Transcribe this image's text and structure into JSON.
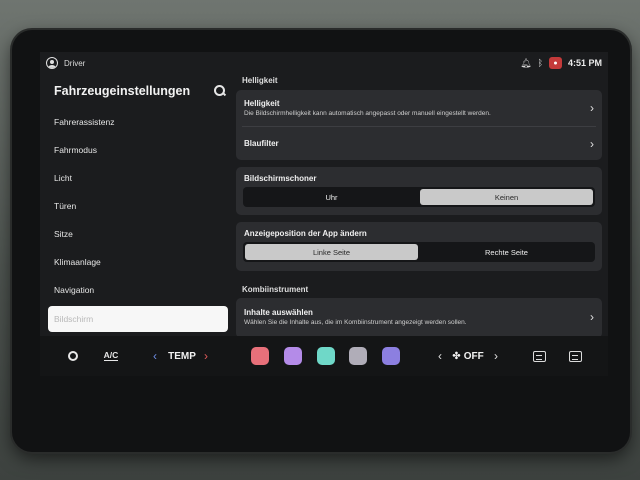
{
  "status": {
    "user": "Driver",
    "icons": [
      "bell-icon",
      "bluetooth-icon",
      "record-icon"
    ],
    "time": "4:51 PM"
  },
  "sidebar": {
    "title": "Fahrzeugeinstellungen",
    "items": [
      {
        "label": "Fahrerassistenz"
      },
      {
        "label": "Fahrmodus"
      },
      {
        "label": "Licht"
      },
      {
        "label": "Türen"
      },
      {
        "label": "Sitze"
      },
      {
        "label": "Klimaanlage"
      },
      {
        "label": "Navigation"
      },
      {
        "label": "Bildschirm"
      }
    ],
    "active_index": 7
  },
  "content": {
    "section_brightness": "Helligkeit",
    "brightness_title": "Helligkeit",
    "brightness_sub": "Die Bildschirmhelligkeit kann automatisch angepasst oder manuell eingestellt werden.",
    "bluefilter_title": "Blaufilter",
    "screensaver": {
      "title": "Bildschirmschoner",
      "options": [
        "Uhr",
        "Keinen"
      ],
      "selected": "Keinen"
    },
    "app_position": {
      "title": "Anzeigeposition der App ändern",
      "options": [
        "Linke Seite",
        "Rechte Seite"
      ],
      "selected": "Linke Seite"
    },
    "section_cluster": "Kombiinstrument",
    "cluster_title": "Inhalte auswählen",
    "cluster_sub": "Wählen Sie die Inhalte aus, die im Kombiinstrument angezeigt werden sollen."
  },
  "bottombar": {
    "ac": "A/C",
    "temp": "TEMP",
    "fan": "OFF",
    "apps": [
      {
        "icon": "app-icon-red",
        "color": "#e8707a"
      },
      {
        "icon": "app-icon-purple",
        "color": "#b48be8"
      },
      {
        "icon": "app-icon-teal",
        "color": "#6fd8c8"
      },
      {
        "icon": "app-icon-gray",
        "color": "#b0adb8"
      },
      {
        "icon": "app-icon-settings",
        "color": "#8c7fe0"
      }
    ]
  }
}
